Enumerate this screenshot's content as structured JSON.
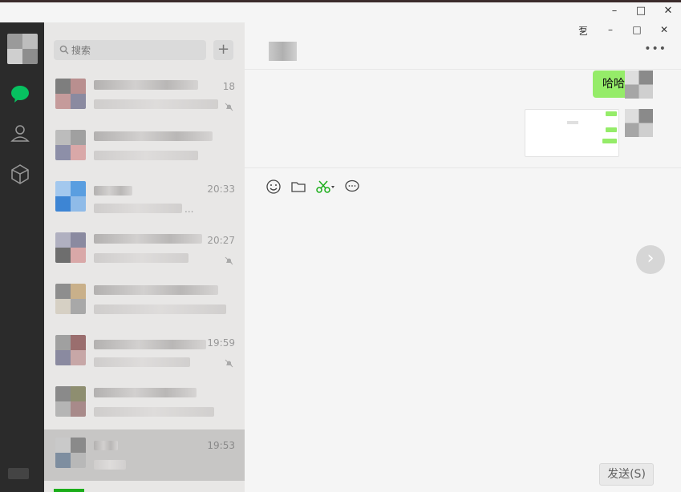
{
  "window": {
    "controls": [
      "–",
      "□",
      "✕"
    ]
  },
  "rail": {
    "icons": [
      "chat-icon",
      "contacts-icon",
      "favorites-icon"
    ],
    "accent": "#07c160"
  },
  "search": {
    "placeholder": "搜索",
    "add_label": "+"
  },
  "conversations": [
    {
      "time": "18",
      "muted": true,
      "preview": ""
    },
    {
      "time": "",
      "muted": false,
      "preview": ""
    },
    {
      "time": "20:33",
      "muted": false,
      "preview": "..."
    },
    {
      "time": "20:27",
      "muted": true,
      "preview": ""
    },
    {
      "time": "",
      "muted": false,
      "preview": ""
    },
    {
      "time": "19:59",
      "muted": true,
      "preview": ""
    },
    {
      "time": "",
      "muted": false,
      "preview": ""
    },
    {
      "time": "19:53",
      "muted": false,
      "preview": "",
      "active": true
    }
  ],
  "chat": {
    "pin_label": "乭",
    "controls": [
      "–",
      "□",
      "✕"
    ],
    "more_label": "•••",
    "messages": [
      {
        "text": "哈哈哈",
        "from": "me"
      }
    ],
    "toolbar": [
      "emoji-icon",
      "folder-icon",
      "scissors-icon",
      "chat-bubble-icon"
    ],
    "next_label": "›",
    "send_label": "发送(S)"
  }
}
